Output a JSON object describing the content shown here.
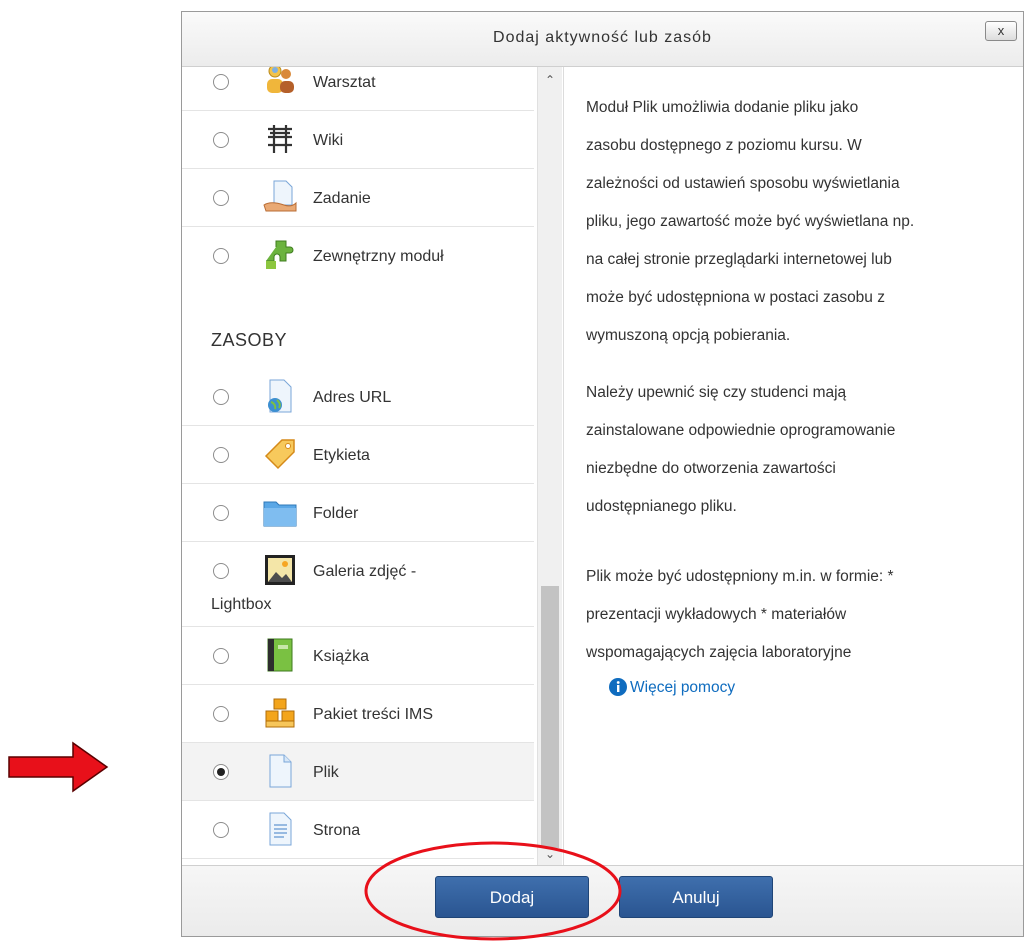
{
  "dialog": {
    "title": "Dodaj aktywność lub zasób",
    "close_label": "x"
  },
  "list": {
    "activities_tail": [
      {
        "label": "Warsztat",
        "icon": "workshop-icon",
        "checked": false
      },
      {
        "label": "Wiki",
        "icon": "wiki-icon",
        "checked": false
      },
      {
        "label": "Zadanie",
        "icon": "assignment-icon",
        "checked": false
      },
      {
        "label": "Zewnętrzny moduł",
        "icon": "external-tool-icon",
        "checked": false
      }
    ],
    "resources_heading": "ZASOBY",
    "resources": [
      {
        "label": "Adres URL",
        "icon": "url-icon",
        "checked": false
      },
      {
        "label": "Etykieta",
        "icon": "label-icon",
        "checked": false
      },
      {
        "label": "Folder",
        "icon": "folder-icon",
        "checked": false
      },
      {
        "label": "Galeria zdjęć -",
        "label2": "Lightbox",
        "icon": "gallery-icon",
        "checked": false
      },
      {
        "label": "Książka",
        "icon": "book-icon",
        "checked": false
      },
      {
        "label": "Pakiet treści IMS",
        "icon": "ims-package-icon",
        "checked": false
      },
      {
        "label": "Plik",
        "icon": "file-icon",
        "checked": true
      },
      {
        "label": "Strona",
        "icon": "page-icon",
        "checked": false
      }
    ]
  },
  "description": {
    "para1_lines": [
      "Moduł Plik umożliwia dodanie pliku jako",
      "zasobu dostępnego z poziomu kursu. W",
      "zależności od ustawień sposobu wyświetlania",
      "pliku, jego zawartość może być wyświetlana np.",
      "na całej stronie przeglądarki internetowej lub",
      "może być udostępniona w postaci zasobu z",
      "wymuszoną opcją pobierania."
    ],
    "para2_lines": [
      "Należy upewnić się czy studenci mają",
      "zainstalowane odpowiednie oprogramowanie",
      "niezbędne do otworzenia zawartości",
      "udostępnianego pliku."
    ],
    "para3_lines": [
      "Plik może być udostępniony m.in. w formie: *",
      "prezentacji wykładowych * materiałów",
      "wspomagających zajęcia laboratoryjne"
    ],
    "help_link": "Więcej pomocy"
  },
  "footer": {
    "add_label": "Dodaj",
    "cancel_label": "Anuluj"
  },
  "colors": {
    "button": "#2f5e9e",
    "link": "#0f6cbf",
    "annotation": "#e8101a"
  }
}
